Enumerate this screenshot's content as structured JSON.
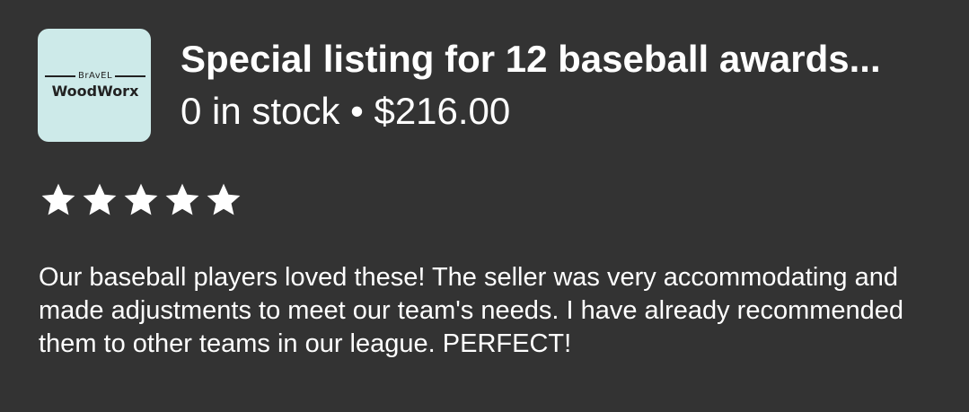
{
  "shop": {
    "logo_brand": "BrAvEL",
    "logo_name": "WoodWorx"
  },
  "listing": {
    "title": "Special listing for 12 baseball awards...",
    "stock_price": "0 in stock • $216.00"
  },
  "review": {
    "rating": 5,
    "rating_max": 5,
    "text": "Our baseball players loved these! The seller was very accommodating and made adjustments to meet our team's needs. I have already recommended them to other teams in our league. PERFECT!"
  },
  "colors": {
    "background": "#333333",
    "text": "#ffffff",
    "logo_bg": "#cdeae9",
    "star": "#ffffff"
  },
  "icons": {
    "star": "star-icon"
  }
}
